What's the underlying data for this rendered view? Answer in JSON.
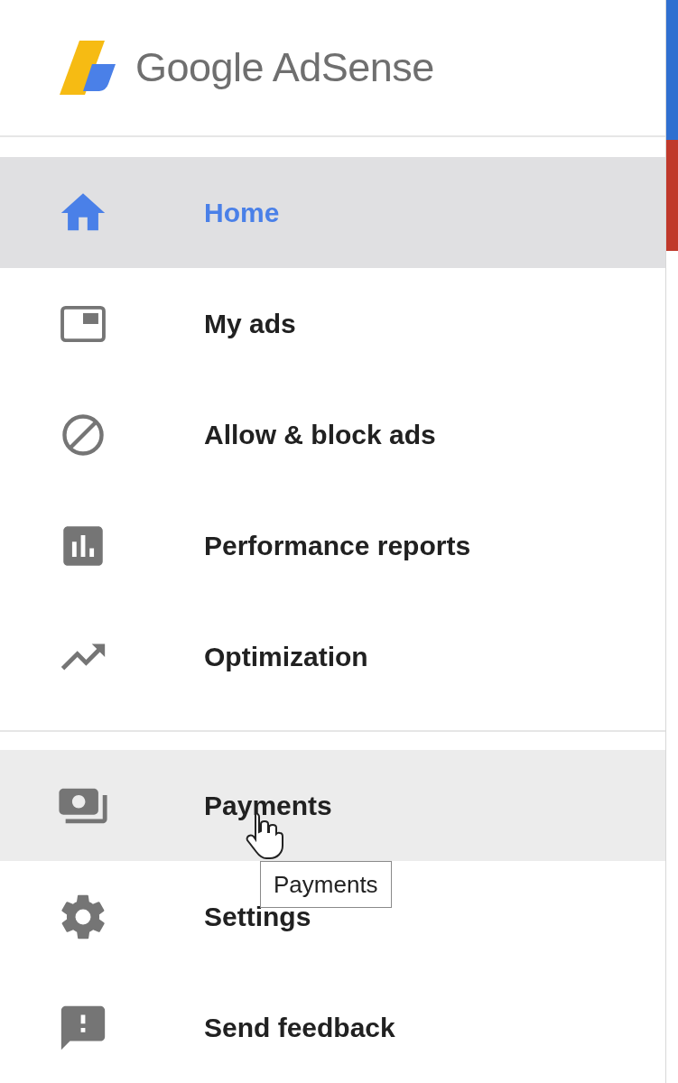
{
  "logo": {
    "text": "Google AdSense"
  },
  "sections": [
    {
      "items": [
        {
          "kind": "home",
          "label": "Home",
          "selected": true,
          "hovered": false
        },
        {
          "kind": "ads",
          "label": "My ads",
          "selected": false,
          "hovered": false
        },
        {
          "kind": "block",
          "label": "Allow & block ads",
          "selected": false,
          "hovered": false
        },
        {
          "kind": "reports",
          "label": "Performance reports",
          "selected": false,
          "hovered": false
        },
        {
          "kind": "optimization",
          "label": "Optimization",
          "selected": false,
          "hovered": false
        }
      ]
    },
    {
      "items": [
        {
          "kind": "payments",
          "label": "Payments",
          "selected": false,
          "hovered": true
        },
        {
          "kind": "settings",
          "label": "Settings",
          "selected": false,
          "hovered": false
        },
        {
          "kind": "feedback",
          "label": "Send feedback",
          "selected": false,
          "hovered": false
        }
      ]
    }
  ],
  "tooltip": {
    "text": "Payments"
  }
}
